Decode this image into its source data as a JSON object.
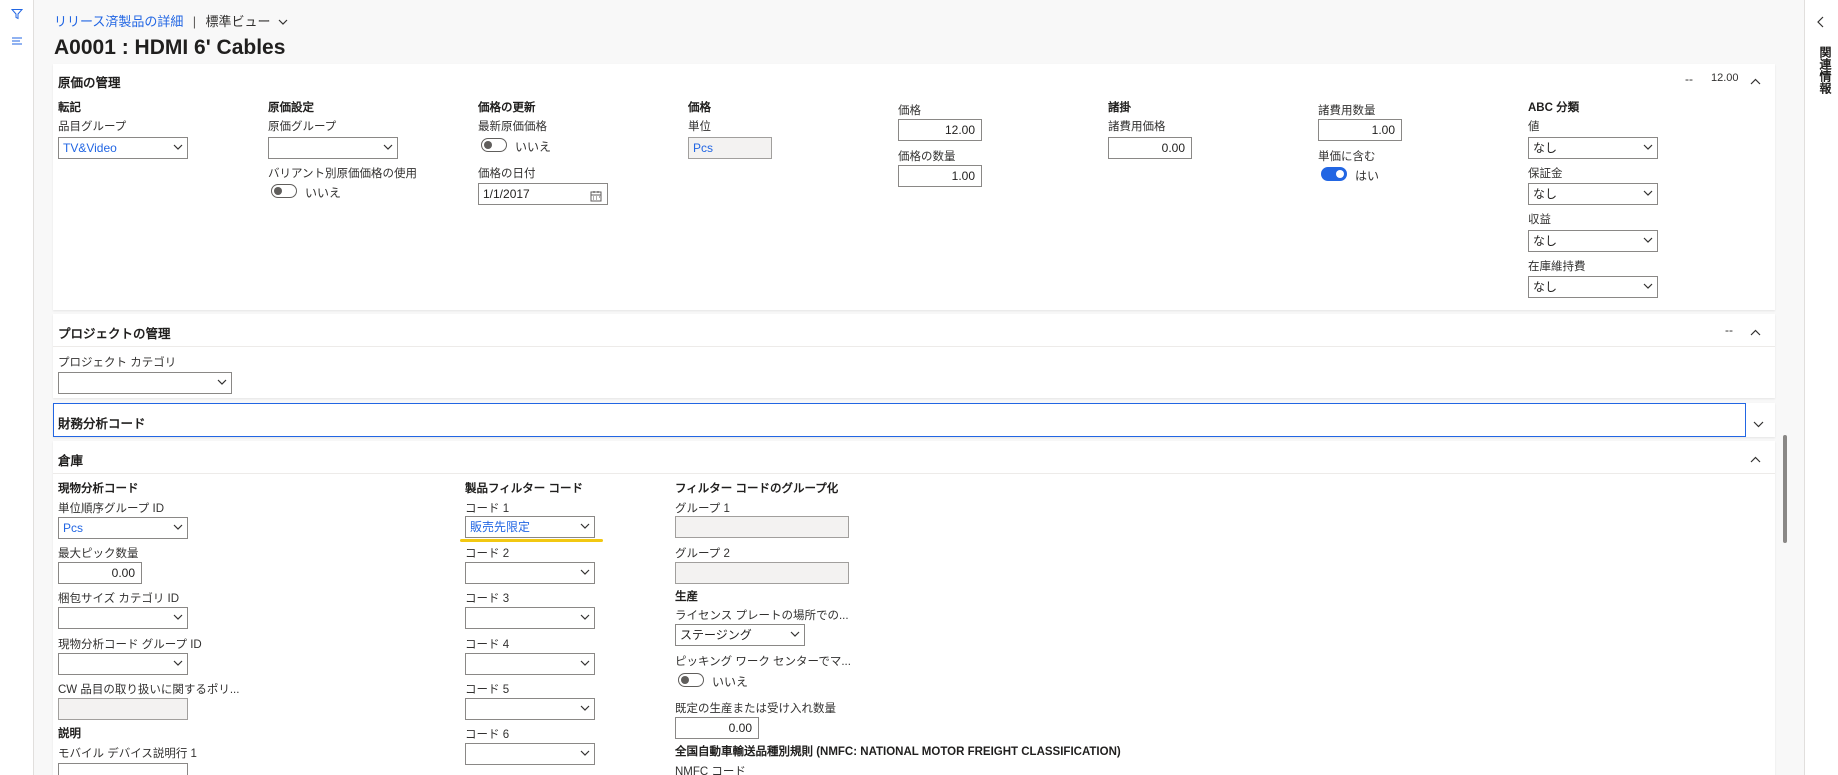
{
  "breadcrumb": {
    "link": "リリース済製品の詳細",
    "separator": "|",
    "view": "標準ビュー"
  },
  "page_title": "A0001 : HDMI 6' Cables",
  "right_rail": {
    "related_info": "関連情報"
  },
  "cost": {
    "header": "原価の管理",
    "summary_dash": "--",
    "summary_value": "12.00",
    "posting": {
      "group": "転記",
      "item_group_label": "品目グループ",
      "item_group_value": "TV&Video"
    },
    "costing_setup": {
      "group": "原価設定",
      "cost_group_label": "原価グループ",
      "cost_group_value": "",
      "variant_label": "バリアント別原価価格の使用",
      "variant_value": "いいえ"
    },
    "price_update": {
      "group": "価格の更新",
      "latest_cost_label": "最新原価価格",
      "latest_cost_value": "いいえ",
      "price_date_label": "価格の日付",
      "price_date_value": "1/1/2017"
    },
    "price": {
      "group": "価格",
      "unit_label": "単位",
      "unit_value": "Pcs",
      "price_label": "価格",
      "price_value": "12.00",
      "price_qty_label": "価格の数量",
      "price_qty_value": "1.00"
    },
    "charges": {
      "group": "諸掛",
      "charges_price_label": "諸費用価格",
      "charges_price_value": "0.00",
      "charges_qty_label": "諸費用数量",
      "charges_qty_value": "1.00",
      "include_label": "単価に含む",
      "include_value": "はい"
    },
    "abc": {
      "group": "ABC 分類",
      "value_label": "値",
      "value_value": "なし",
      "margin_label": "保証金",
      "margin_value": "なし",
      "revenue_label": "収益",
      "revenue_value": "なし",
      "carrying_label": "在庫維持費",
      "carrying_value": "なし"
    }
  },
  "project": {
    "header": "プロジェクトの管理",
    "dash": "--",
    "category_label": "プロジェクト カテゴリ",
    "category_value": ""
  },
  "financial": {
    "header": "財務分析コード"
  },
  "warehouse": {
    "header": "倉庫",
    "storage": {
      "group": "現物分析コード",
      "unit_seq_label": "単位順序グループ ID",
      "unit_seq_value": "Pcs",
      "max_pick_label": "最大ピック数量",
      "max_pick_value": "0.00",
      "pack_size_label": "梱包サイズ カテゴリ ID",
      "pack_size_value": "",
      "dim_group_label": "現物分析コード グループ ID",
      "dim_group_value": "",
      "cw_label": "CW 品目の取り扱いに関するポリ...",
      "cw_value": ""
    },
    "description": {
      "group": "説明",
      "mobile_label": "モバイル デバイス説明行 1"
    },
    "filter": {
      "group": "製品フィルター コード",
      "code1_label": "コード 1",
      "code1_value": "販売先限定",
      "code2_label": "コード 2",
      "code3_label": "コード 3",
      "code4_label": "コード 4",
      "code5_label": "コード 5",
      "code6_label": "コード 6"
    },
    "grouping": {
      "group": "フィルター コードのグループ化",
      "group1_label": "グループ 1",
      "group2_label": "グループ 2"
    },
    "production": {
      "group": "生産",
      "license_label": "ライセンス プレートの場所での...",
      "license_value": "ステージング",
      "picking_label": "ピッキング ワーク センターでマ...",
      "picking_value": "いいえ",
      "default_qty_label": "既定の生産または受け入れ数量",
      "default_qty_value": "0.00"
    },
    "nmfc": {
      "group": "全国自動車輸送品種別規則 (NMFC: NATIONAL MOTOR FREIGHT CLASSIFICATION)",
      "code_label": "NMFC コード"
    }
  },
  "colors": {
    "accent": "#2266e3",
    "highlight": "#f2c811"
  }
}
